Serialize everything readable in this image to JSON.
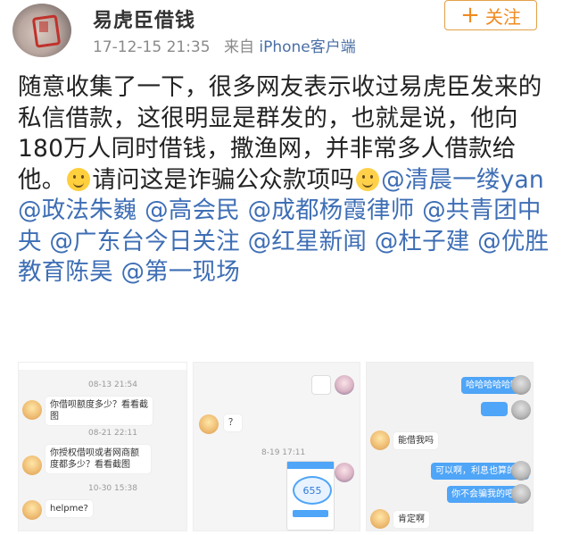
{
  "post": {
    "username": "易虎臣借钱",
    "timestamp": "17-12-15 21:35",
    "source_prefix": "来自",
    "source": "iPhone客户端",
    "follow_label": "关注",
    "text_part1": "随意收集了一下，很多网友表示收过易虎臣发来的私信借款，这很明显是群发的，也就是说，他向180万人同时借钱，撒渔网，并非常多人借款给他。",
    "text_part2": "请问这是诈骗公众款项吗",
    "mentions": [
      "@清晨一缕yan",
      "@政法朱巍",
      "@高会民",
      "@成都杨霞律师",
      "@共青团中央",
      "@广东台今日关注",
      "@红星新闻",
      "@杜子建",
      "@优胜教育陈昊",
      "@第一现场"
    ]
  },
  "screenshot1": {
    "time1": "08-13 21:54",
    "msg1": "你借呗额度多少？看看截图",
    "time2": "08-21 22:11",
    "msg2": "你授权借呗或者网商额度都多少？看看截图",
    "time3": "10-30 15:38",
    "msg3": "helpme?"
  },
  "screenshot2": {
    "msg1": "？",
    "time": "8-19 17:11",
    "card_value": "655"
  },
  "screenshot3": {
    "msg1": "哈哈哈哈哈哈",
    "msg2": "能借我吗",
    "msg3": "可以啊，利息也算的吗",
    "msg4": "你不会骗我的吧",
    "msg5": "肯定啊"
  },
  "colors": {
    "mention": "#3e6eb5",
    "follow": "#f08a1f",
    "source": "#4a6fa5"
  }
}
